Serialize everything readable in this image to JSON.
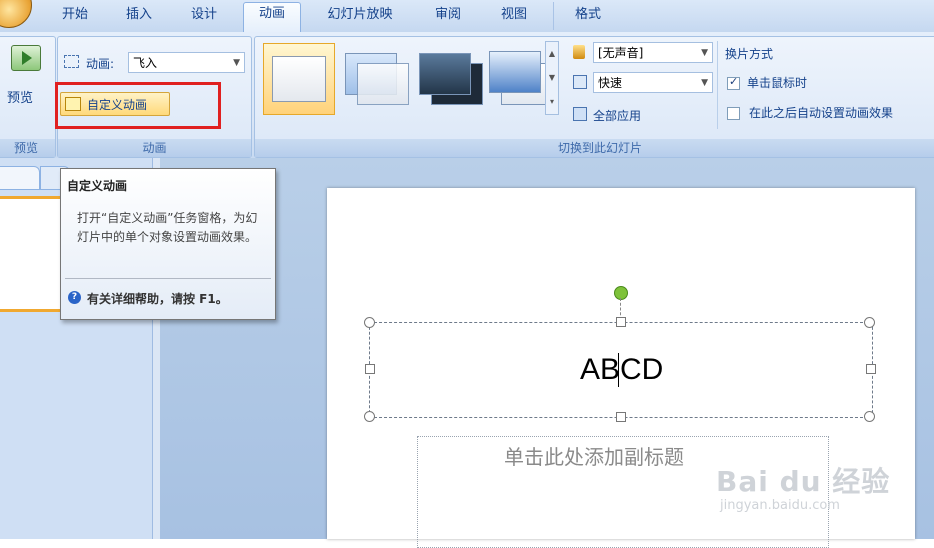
{
  "tabs": [
    {
      "label": "开始",
      "active": false
    },
    {
      "label": "插入",
      "active": false
    },
    {
      "label": "设计",
      "active": false
    },
    {
      "label": "动画",
      "active": true
    },
    {
      "label": "幻灯片放映",
      "active": false
    },
    {
      "label": "审阅",
      "active": false
    },
    {
      "label": "视图",
      "active": false
    },
    {
      "label": "格式",
      "active": false
    }
  ],
  "ribbon": {
    "preview_group": {
      "button_label": "预览",
      "group_label": "预览"
    },
    "animation_group": {
      "animation_label": "动画:",
      "animation_value": "飞入",
      "custom_animation_button": "自定义动画",
      "group_label": "动画"
    },
    "transition_group": {
      "sound_value": "[无声音]",
      "speed_value": "快速",
      "apply_all": "全部应用",
      "advance_title": "换片方式",
      "on_click_label": "单击鼠标时",
      "on_click_checked": true,
      "auto_after_label": "在此之后自动设置动画效果",
      "auto_after_checked": false,
      "group_label": "切换到此幻灯片"
    }
  },
  "tooltip": {
    "title": "自定义动画",
    "body": "打开“自定义动画”任务窗格，为幻灯片中的单个对象设置动画效果。",
    "help": "有关详细帮助，请按 F1。"
  },
  "slide": {
    "title_text": "ABCD",
    "subtitle_placeholder": "单击此处添加副标题"
  },
  "watermark": {
    "brand": "Bai du 经验",
    "url": "jingyan.baidu.com"
  },
  "colors": {
    "highlight_box": "#e02020",
    "accent_orange": "#f3b64a",
    "ribbon_text": "#15428b"
  }
}
